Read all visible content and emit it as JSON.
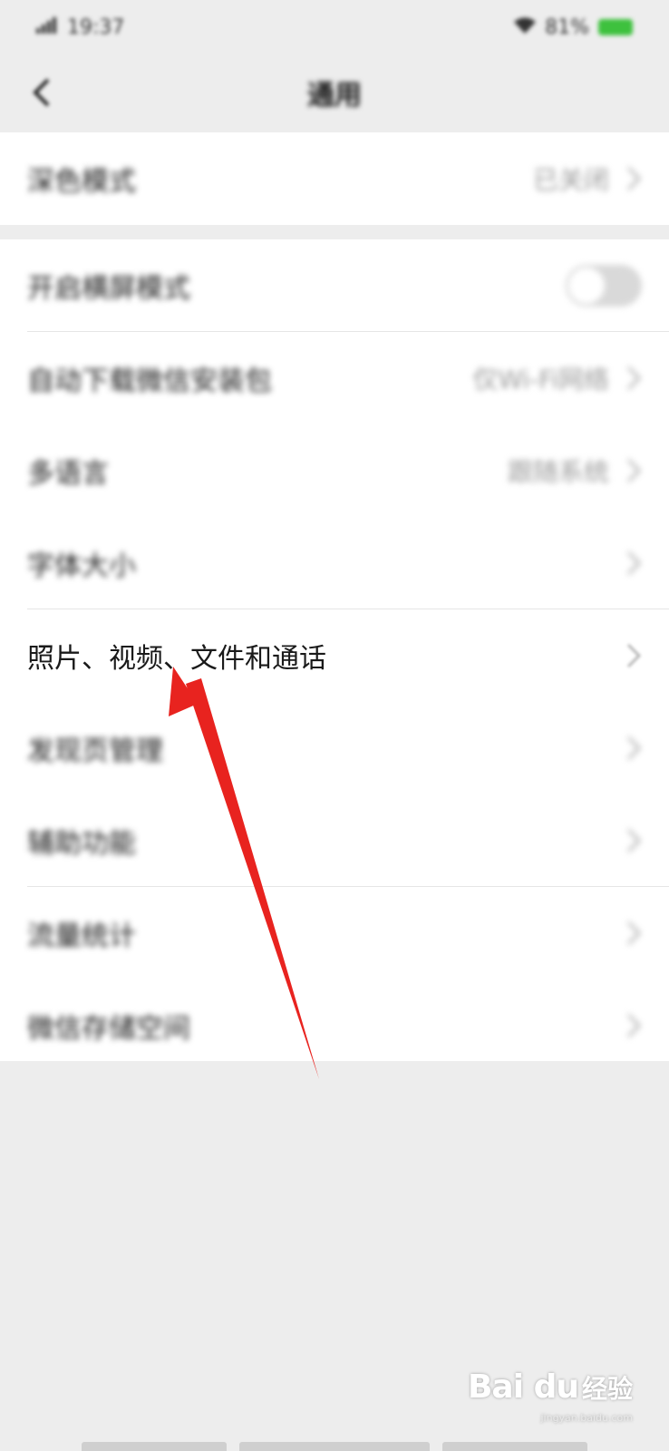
{
  "status_bar": {
    "time": "19:37",
    "battery": "81%"
  },
  "nav": {
    "title": "通用"
  },
  "groups": [
    {
      "items": [
        {
          "label": "深色模式",
          "value": "已关闭",
          "type": "link"
        }
      ]
    },
    {
      "items": [
        {
          "label": "开启横屏模式",
          "type": "toggle",
          "on": false
        },
        {
          "label": "自动下载微信安装包",
          "value": "仅Wi-Fi网络",
          "type": "link"
        },
        {
          "label": "多语言",
          "value": "跟随系统",
          "type": "link"
        },
        {
          "label": "字体大小",
          "type": "link"
        },
        {
          "label": "照片、视频、文件和通话",
          "type": "link",
          "highlighted": true
        },
        {
          "label": "发现页管理",
          "type": "link"
        },
        {
          "label": "辅助功能",
          "type": "link"
        },
        {
          "label": "流量统计",
          "type": "link"
        },
        {
          "label": "微信存储空间",
          "type": "link"
        }
      ]
    }
  ],
  "annotation": {
    "color": "#e8231f"
  },
  "watermark": {
    "logo": "Bai du",
    "text": "经验",
    "sub": "jingyan.baidu.com"
  },
  "colors": {
    "background": "#ededed",
    "card": "#ffffff",
    "toggle_off": "#d9d9d9"
  }
}
